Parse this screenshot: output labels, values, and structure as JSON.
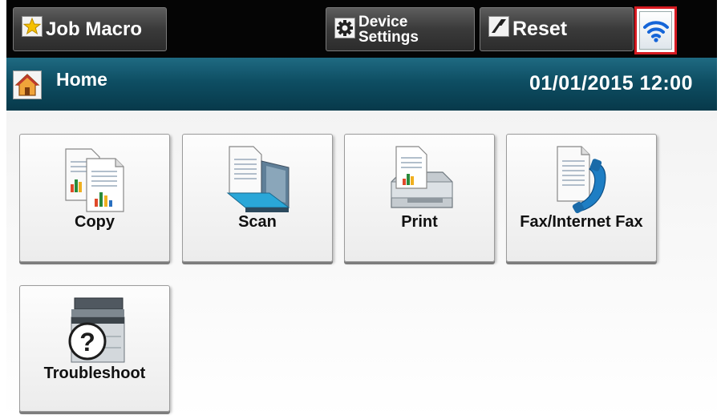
{
  "topbar": {
    "job_macro_label": "Job Macro",
    "device_settings_line1": "Device",
    "device_settings_line2": "Settings",
    "reset_label": "Reset"
  },
  "homebar": {
    "title": "Home",
    "datetime": "01/01/2015 12:00"
  },
  "tiles": [
    {
      "label": "Copy",
      "icon": "copy-icon"
    },
    {
      "label": "Scan",
      "icon": "scan-icon"
    },
    {
      "label": "Print",
      "icon": "print-icon"
    },
    {
      "label": "Fax/Internet Fax",
      "icon": "fax-icon"
    },
    {
      "label": "Troubleshoot",
      "icon": "troubleshoot-icon"
    }
  ],
  "colors": {
    "topbar": "#050505",
    "homebar": "#0e4e63",
    "wifi_highlight": "#d61a21",
    "wifi_icon": "#1565d8"
  }
}
